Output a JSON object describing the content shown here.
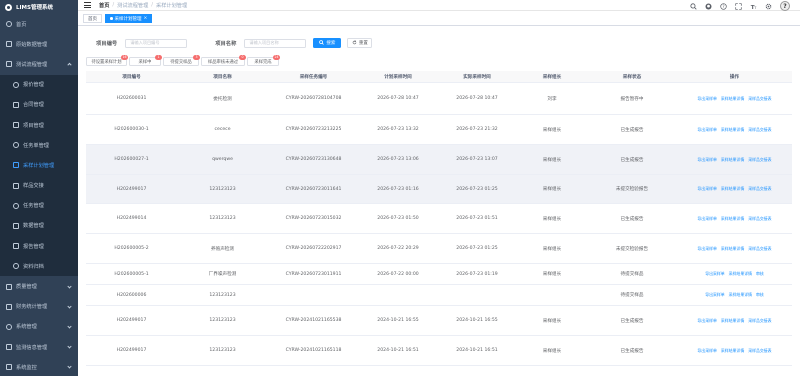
{
  "app": {
    "title": "LIMS管理系统"
  },
  "sidebar": {
    "items": [
      {
        "label": "首页",
        "icon": "home-icon",
        "name": "sidebar-item-home"
      },
      {
        "label": "原始数据管理",
        "icon": "database-icon",
        "name": "sidebar-item-raw-data"
      },
      {
        "label": "测试流程管理",
        "icon": "flow-icon",
        "name": "sidebar-item-test-flow",
        "expanded": true
      },
      {
        "label": "报价管理",
        "icon": "quote-icon",
        "name": "sidebar-item-quote",
        "sub": true
      },
      {
        "label": "合同管理",
        "icon": "contract-icon",
        "name": "sidebar-item-contract",
        "sub": true
      },
      {
        "label": "项目管理",
        "icon": "project-icon",
        "name": "sidebar-item-project",
        "sub": true
      },
      {
        "label": "任务单管理",
        "icon": "task-icon",
        "name": "sidebar-item-task-order",
        "sub": true
      },
      {
        "label": "采样计划管理",
        "icon": "plan-icon",
        "name": "sidebar-item-sampling-plan",
        "sub": true,
        "active": true
      },
      {
        "label": "样品交接",
        "icon": "sample-icon",
        "name": "sidebar-item-sample-handover",
        "sub": true
      },
      {
        "label": "任务管理",
        "icon": "tasks-icon",
        "name": "sidebar-item-tasks",
        "sub": true
      },
      {
        "label": "数据管理",
        "icon": "data-icon",
        "name": "sidebar-item-data",
        "sub": true
      },
      {
        "label": "报告管理",
        "icon": "report-icon",
        "name": "sidebar-item-report",
        "sub": true
      },
      {
        "label": "资料归档",
        "icon": "archive-icon",
        "name": "sidebar-item-archive",
        "sub": true
      },
      {
        "label": "质量管理",
        "icon": "quality-icon",
        "name": "sidebar-item-quality",
        "chevron": true
      },
      {
        "label": "财务统计管理",
        "icon": "finance-icon",
        "name": "sidebar-item-finance",
        "chevron": true
      },
      {
        "label": "系统管理",
        "icon": "gear-icon",
        "name": "sidebar-item-system",
        "chevron": true
      },
      {
        "label": "监测信息管理",
        "icon": "monitor-icon",
        "name": "sidebar-item-monitor-info",
        "chevron": true
      },
      {
        "label": "系统监控",
        "icon": "eye-icon",
        "name": "sidebar-item-system-monitor",
        "chevron": true
      }
    ]
  },
  "header": {
    "breadcrumb": [
      "首页",
      "测试流程管理",
      "采样计划管理"
    ],
    "avatar_text": "?"
  },
  "tags": {
    "home": "首页",
    "active": "采样计划管理"
  },
  "search": {
    "project_no_label": "项目编号",
    "project_no_placeholder": "请输入项目编号",
    "project_name_label": "项目名称",
    "project_name_placeholder": "请输入项目名称",
    "search_btn": "搜索",
    "reset_btn": "重置"
  },
  "status_tabs": [
    {
      "label": "待设置采样计划",
      "count": "16"
    },
    {
      "label": "采样中",
      "count": "1"
    },
    {
      "label": "待提交样品",
      "count": "3"
    },
    {
      "label": "样品审核未通过",
      "count": "0"
    },
    {
      "label": "采样完成",
      "count": "24"
    }
  ],
  "table": {
    "columns": [
      "项目编号",
      "项目名称",
      "采样任务编号",
      "计划采样时间",
      "实际采样时间",
      "采样组长",
      "采样状态",
      "操作"
    ],
    "rows": [
      {
        "project_no": "H202600031",
        "project_name": "委托检测",
        "task_no": "CYRW-20260728104708",
        "plan_time": "2026-07-28 10:47",
        "actual_time": "2026-07-28 10:47",
        "leader": "刘李",
        "status": "报告暂存中",
        "ops": [
          "导出采样单",
          "采样结果详情",
          "采样品交接表"
        ]
      },
      {
        "project_no": "H202600030-1",
        "project_name": "cecece",
        "task_no": "CYRW-20260723213225",
        "plan_time": "2026-07-23 13:32",
        "actual_time": "2026-07-23 21:32",
        "leader": "采样组长",
        "status": "已生成报告",
        "ops": [
          "导出采样单",
          "采样结果详情",
          "采样品交接表"
        ]
      },
      {
        "project_no": "H202600027-1",
        "project_name": "qwerqwe",
        "task_no": "CYRW-20260723130648",
        "plan_time": "2026-07-23 13:06",
        "actual_time": "2026-07-23 13:07",
        "leader": "采样组长",
        "status": "已生成报告",
        "ops": [
          "导出采样单",
          "采样结果详情",
          "采样品交接表"
        ]
      },
      {
        "project_no": "H202499017",
        "project_name": "123123123",
        "task_no": "CYRW-20260723011641",
        "plan_time": "2026-07-23 01:16",
        "actual_time": "2026-07-23 01:25",
        "leader": "采样组长",
        "status": "未提交检验报告",
        "ops": [
          "导出采样单",
          "采样结果详情",
          "采样品交接表"
        ]
      },
      {
        "project_no": "H202499014",
        "project_name": "123123123",
        "task_no": "CYRW-20260723015032",
        "plan_time": "2026-07-23 01:50",
        "actual_time": "2026-07-23 01:51",
        "leader": "采样组长",
        "status": "已生成报告",
        "ops": [
          "导出采样单",
          "采样结果详情",
          "采样品交接表"
        ]
      },
      {
        "project_no": "H202600005-2",
        "project_name": "养殖声检测",
        "task_no": "CYRW-20260722202917",
        "plan_time": "2026-07-22 20:29",
        "actual_time": "2026-07-23 01:25",
        "leader": "采样组长",
        "status": "未提交检验报告",
        "ops": [
          "导出采样单",
          "采样结果详情",
          "采样品交接表"
        ]
      },
      {
        "project_no": "H202600005-1",
        "project_name": "厂界噪声检测",
        "task_no": "CYRW-20260723011911",
        "plan_time": "2026-07-22 00:00",
        "actual_time": "2026-07-23 01:19",
        "leader": "采样组长",
        "status": "待提交样品",
        "ops": [
          "导出采样单",
          "采样结果详情",
          "审核"
        ]
      },
      {
        "project_no": "H202600006",
        "project_name": "123123123",
        "task_no": "",
        "plan_time": "",
        "actual_time": "",
        "leader": "",
        "status": "待提交样品",
        "ops": [
          "导出采样单",
          "采样结果详情",
          "审核"
        ]
      },
      {
        "project_no": "H202499017",
        "project_name": "123123123",
        "task_no": "CYRW-20241021165538",
        "plan_time": "2024-10-21 16:55",
        "actual_time": "2024-10-21 16:55",
        "leader": "采样组长",
        "status": "已生成报告",
        "ops": [
          "导出采样单",
          "采样结果详情",
          "采样品交接表"
        ]
      },
      {
        "project_no": "H202499017",
        "project_name": "123123123",
        "task_no": "CYRW-20241021165118",
        "plan_time": "2024-10-21 16:51",
        "actual_time": "2024-10-21 16:51",
        "leader": "采样组长",
        "status": "已生成报告",
        "ops": [
          "导出采样单",
          "采样结果详情",
          "采样品交接表"
        ]
      }
    ]
  },
  "colors": {
    "sidebar_bg": "#304156",
    "accent": "#1890ff",
    "badge": "#f56c6c"
  }
}
